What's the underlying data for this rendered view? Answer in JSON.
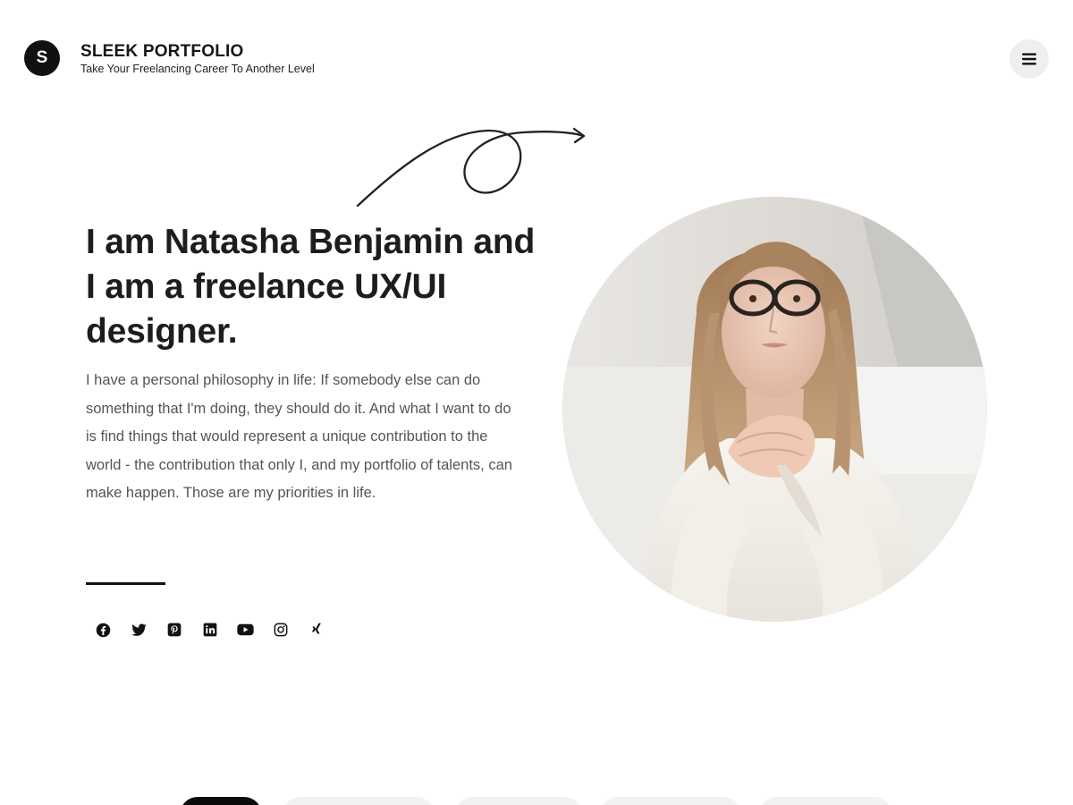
{
  "header": {
    "logo_letter": "S",
    "title": "SLEEK PORTFOLIO",
    "tagline": "Take Your Freelancing Career To Another Level",
    "menu_icon": "hamburger-icon"
  },
  "hero": {
    "heading": "I am Natasha Benjamin and I am a freelance UX/UI designer.",
    "paragraph": "I have a personal philosophy in life: If somebody else can do something that I'm doing, they should do it. And what I want to do is find things that would represent a unique contribution to the world - the contribution that only I, and my portfolio of talents, can make happen. Those are my priorities in life.",
    "portrait_alt": "Portrait of a woman with long hair and glasses, hands clasped"
  },
  "social_links": [
    {
      "icon": "facebook-icon"
    },
    {
      "icon": "twitter-icon"
    },
    {
      "icon": "pinterest-icon"
    },
    {
      "icon": "linkedin-icon"
    },
    {
      "icon": "youtube-icon"
    },
    {
      "icon": "instagram-icon"
    },
    {
      "icon": "xing-icon"
    }
  ],
  "colors": {
    "text_dark": "#1d1d1d",
    "text_body": "#555555",
    "menu_bg": "#efefef",
    "active_tab": "#0b0b0b"
  }
}
